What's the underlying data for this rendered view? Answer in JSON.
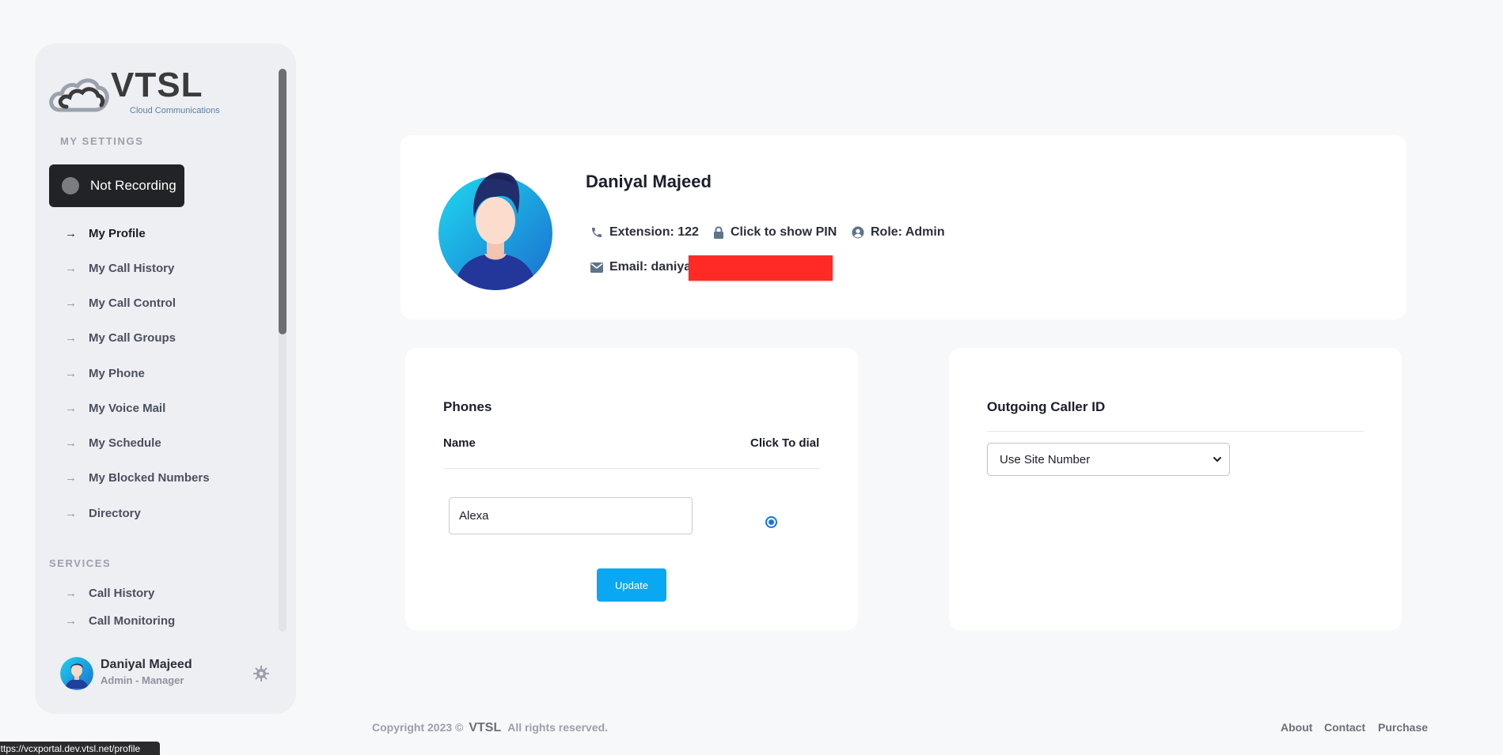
{
  "sidebar": {
    "logo": {
      "brand": "VTSL",
      "tagline": "Cloud Communications"
    },
    "my_settings_label": "MY SETTINGS",
    "recording_label": "Not Recording",
    "items": [
      {
        "label": "My Profile",
        "active": true
      },
      {
        "label": "My Call History"
      },
      {
        "label": "My Call Control"
      },
      {
        "label": "My Call Groups"
      },
      {
        "label": "My Phone"
      },
      {
        "label": "My Voice Mail"
      },
      {
        "label": "My Schedule"
      },
      {
        "label": "My Blocked Numbers"
      },
      {
        "label": "Directory"
      }
    ],
    "services_label": "SERVICES",
    "services": [
      {
        "label": "Call History"
      },
      {
        "label": "Call Monitoring"
      }
    ],
    "user": {
      "name": "Daniyal Majeed",
      "role": "Admin - Manager"
    }
  },
  "profile": {
    "name": "Daniyal Majeed",
    "extension": "Extension: 122",
    "pin": "Click to show PIN",
    "role": "Role: Admin",
    "email": "Email: daniyal"
  },
  "phones": {
    "title": "Phones",
    "col_name": "Name",
    "col_dial": "Click To dial",
    "rows": [
      {
        "name": "Alexa",
        "selected": true
      }
    ],
    "update_label": "Update"
  },
  "caller_id": {
    "title": "Outgoing Caller ID",
    "selected": "Use Site Number"
  },
  "footer": {
    "copyright": "Copyright 2023 ©",
    "brand": "VTSL",
    "rights": "All rights reserved.",
    "links": [
      "About",
      "Contact",
      "Purchase"
    ]
  },
  "statusbar": {
    "url": "https://vcxportal.dev.vtsl.net/profile"
  },
  "colors": {
    "accent": "#0aa8f3",
    "sidebar_bg": "#eeeff2",
    "recording_bg": "#222326",
    "redaction": "#ff2a26"
  }
}
